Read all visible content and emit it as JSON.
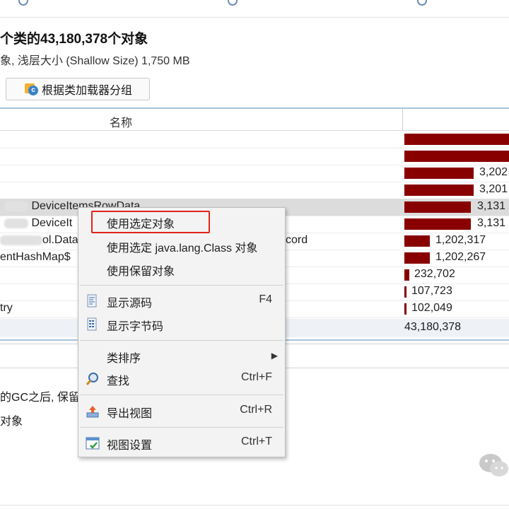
{
  "header": {
    "title": "个类的43,180,378个对象",
    "subtitle": "象, 浅层大小 (Shallow Size) 1,750 MB"
  },
  "toolbar": {
    "group_label": "根据类加载器分组"
  },
  "table": {
    "name_header": "名称",
    "rows": [
      {
        "name": "",
        "value": ""
      },
      {
        "name": "",
        "value": ""
      },
      {
        "name": "",
        "value": "3,202"
      },
      {
        "name": "",
        "value": "3,201"
      },
      {
        "name": "DeviceItemsRowData",
        "value": "3,131"
      },
      {
        "name": "DeviceIt",
        "value": "3,131"
      },
      {
        "name": "ol.Data",
        "suffix": "cord",
        "value": "1,202,317"
      },
      {
        "name": "entHashMap$",
        "value": "1,202,267"
      },
      {
        "name": "",
        "value": "232,702"
      },
      {
        "name": "",
        "value": "107,723"
      },
      {
        "name": "try",
        "value": "102,049"
      }
    ],
    "rows_real": [
      {
        "name": "",
        "value": "",
        "fraction": 1.0
      },
      {
        "name": "",
        "value": "",
        "fraction": 1.0
      },
      {
        "name": "",
        "value": "3,202",
        "fraction": 0.66
      },
      {
        "name": "",
        "value": "3,201",
        "fraction": 0.66
      },
      {
        "name": "DeviceItemsRowData",
        "value": "3,131",
        "fraction": 0.64
      },
      {
        "name": "DeviceIt",
        "value": "3,131",
        "fraction": 0.64
      },
      {
        "name": "ol.Data",
        "suffix": "cord",
        "value": "1,202,317",
        "fraction": 0.25
      },
      {
        "name": "entHashMap$",
        "value": "1,202,267",
        "fraction": 0.25
      },
      {
        "name": "",
        "value": "232,702",
        "fraction": 0.05
      },
      {
        "name": "try",
        "value": "107,723",
        "fraction": 0.02
      },
      {
        "name": "",
        "value": "102,049",
        "fraction": 0.02
      }
    ],
    "total": "43,180,378"
  },
  "lower": {
    "desc1": "的GC之后, 保留",
    "desc2": "对象"
  },
  "context_menu": {
    "items": [
      {
        "label": "使用选定对象",
        "shortcut": "",
        "icon": ""
      },
      {
        "label": "使用选定 java.lang.Class 对象",
        "shortcut": "",
        "icon": ""
      },
      {
        "label": "使用保留对象",
        "shortcut": "",
        "icon": ""
      },
      {
        "label": "显示源码",
        "shortcut": "F4",
        "icon": "source-code-icon"
      },
      {
        "label": "显示字节码",
        "shortcut": "",
        "icon": "bytecode-icon"
      },
      {
        "label": "类排序",
        "shortcut": "",
        "icon": "",
        "submenu": true
      },
      {
        "label": "查找",
        "shortcut": "Ctrl+F",
        "icon": "magnifier-icon"
      },
      {
        "label": "导出视图",
        "shortcut": "Ctrl+R",
        "icon": "export-icon"
      },
      {
        "label": "视图设置",
        "shortcut": "Ctrl+T",
        "icon": "view-settings-icon"
      }
    ]
  },
  "colors": {
    "bar": "#880000",
    "highlight_border": "#e2231a",
    "table_border": "#a9c3da"
  }
}
